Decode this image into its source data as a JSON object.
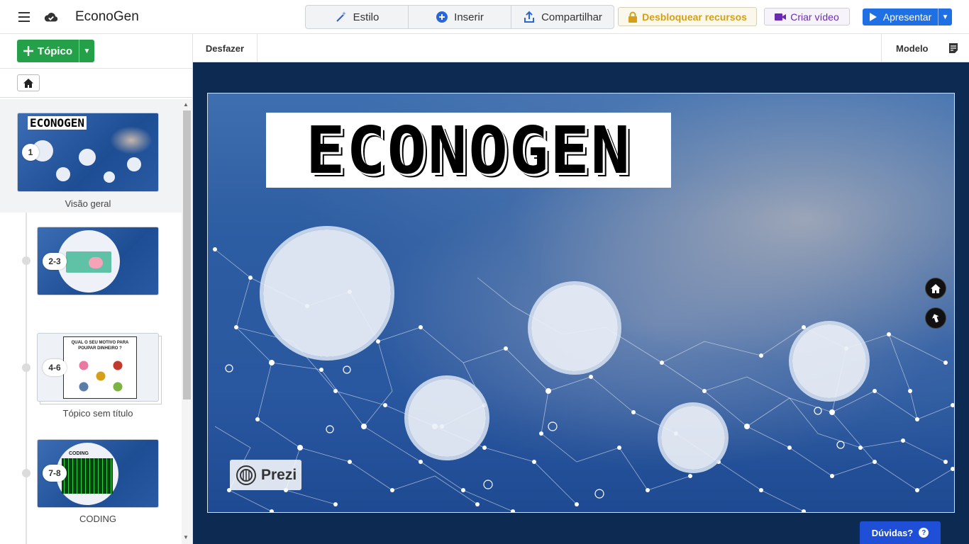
{
  "header": {
    "app_title": "EconoGen",
    "style_label": "Estilo",
    "insert_label": "Inserir",
    "share_label": "Compartilhar",
    "unlock_label": "Desbloquear recursos",
    "video_label": "Criar vídeo",
    "present_label": "Apresentar"
  },
  "sidebar": {
    "topic_label": "Tópico",
    "items": [
      {
        "badge": "1",
        "label": "Visão geral",
        "thumb_title": "ECONOGEN"
      },
      {
        "badge": "2-3",
        "label": ""
      },
      {
        "badge": "4-6",
        "label": "Tópico sem título",
        "thumb_text": "QUAL O SEU MOTIVO PARA POUPAR DINHEIRO ?"
      },
      {
        "badge": "7-8",
        "label": "CODING",
        "thumb_title": "CODING"
      }
    ]
  },
  "toolbar": {
    "undo_label": "Desfazer",
    "model_label": "Modelo"
  },
  "slide": {
    "title": "ECONOGEN",
    "watermark": "Prezi"
  },
  "help": {
    "label": "Dúvidas?"
  },
  "colors": {
    "brand_green": "#24a148",
    "present_blue": "#1f6fe5",
    "canvas_navy": "#0d2a52",
    "unlock_gold": "#d4a017",
    "video_purple": "#6a2bb3"
  }
}
